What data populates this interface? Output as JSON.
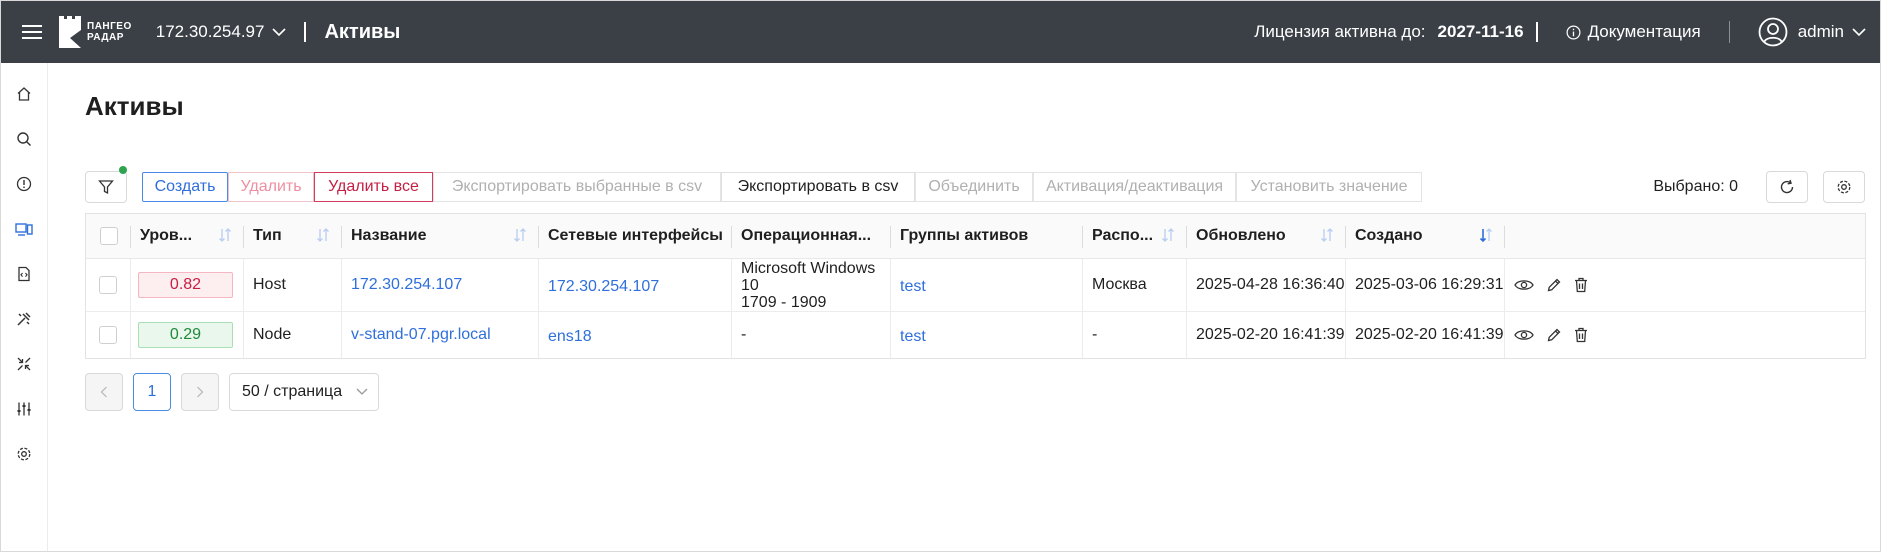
{
  "header": {
    "logo_line1": "ПАНГЕО",
    "logo_line2": "РАДАР",
    "server": "172.30.254.97",
    "page_title": "Активы",
    "license_label": "Лицензия активна до:",
    "license_date": "2027-11-16",
    "docs_label": "Документация",
    "user_name": "admin",
    "bg_color": "#3b4047"
  },
  "sidebar": {
    "items": [
      "home-icon",
      "search-icon",
      "info-icon",
      "assets-icon",
      "code-icon",
      "tools-icon",
      "collapse-icon",
      "sliders-icon",
      "settings-icon"
    ],
    "active_index": 3,
    "active_color": "#2f6fdb"
  },
  "main": {
    "title": "Активы"
  },
  "toolbar": {
    "create": "Создать",
    "delete": "Удалить",
    "delete_all": "Удалить все",
    "export_selected": "Экспортировать выбранные в csv",
    "export_csv": "Экспортировать в csv",
    "merge": "Объединить",
    "activation": "Активация/деактивация",
    "set_value": "Установить значение",
    "selected_label": "Выбрано: 0"
  },
  "table": {
    "columns": [
      "Уров...",
      "Тип",
      "Название",
      "Сетевые интерфейсы",
      "Операционная...",
      "Группы активов",
      "Распо...",
      "Обновлено",
      "Создано"
    ],
    "rows": [
      {
        "level": "0.82",
        "level_state": "high",
        "type": "Host",
        "name": "172.30.254.107",
        "interfaces": "172.30.254.107",
        "os_line1": "Microsoft Windows 10",
        "os_line2": "1709 - 1909",
        "groups": "test",
        "location": "Москва",
        "updated": "2025-04-28 16:36:40",
        "created": "2025-03-06 16:29:31"
      },
      {
        "level": "0.29",
        "level_state": "low",
        "type": "Node",
        "name": "v-stand-07.pgr.local",
        "interfaces": "ens18",
        "os_line1": "-",
        "os_line2": "",
        "groups": "test",
        "location": "-",
        "updated": "2025-02-20 16:41:39",
        "created": "2025-02-20 16:41:39"
      }
    ]
  },
  "pagination": {
    "current_page": "1",
    "page_size": "50 / страница"
  }
}
